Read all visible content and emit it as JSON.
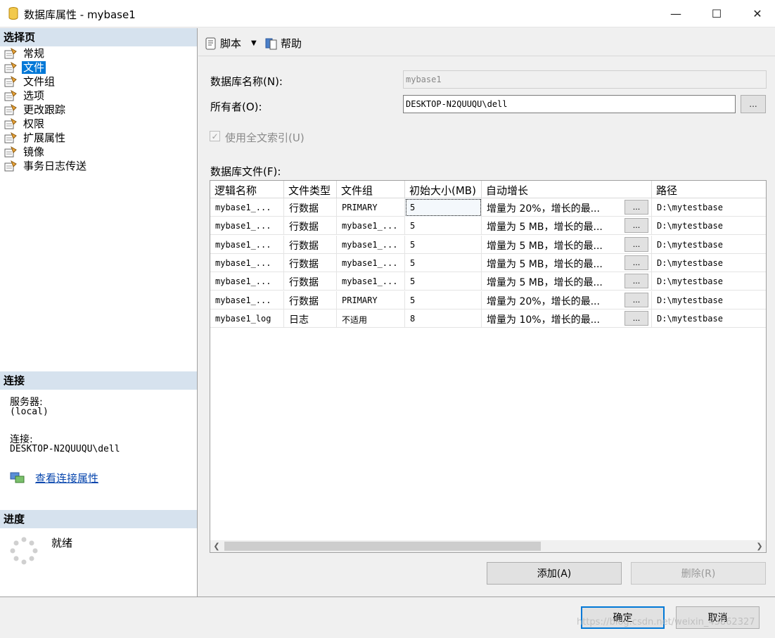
{
  "window": {
    "title": "数据库属性 - mybase1"
  },
  "left": {
    "select_page_header": "选择页",
    "pages": [
      "常规",
      "文件",
      "文件组",
      "选项",
      "更改跟踪",
      "权限",
      "扩展属性",
      "镜像",
      "事务日志传送"
    ],
    "selected_index": 1,
    "connection_header": "连接",
    "server_label": "服务器:",
    "server_value": "(local)",
    "connection_label": "连接:",
    "connection_value": "DESKTOP-N2QUUQU\\dell",
    "view_props_link": "查看连接属性",
    "progress_header": "进度",
    "progress_status": "就绪"
  },
  "toolbar": {
    "script_label": "脚本",
    "help_label": "帮助"
  },
  "form": {
    "db_name_label": "数据库名称(N):",
    "db_name_value": "mybase1",
    "owner_label": "所有者(O):",
    "owner_value": "DESKTOP-N2QUUQU\\dell",
    "ellipsis": "...",
    "fulltext_label": "使用全文索引(U)",
    "files_label": "数据库文件(F):"
  },
  "grid": {
    "columns": [
      "逻辑名称",
      "文件类型",
      "文件组",
      "初始大小(MB)",
      "自动增长",
      "路径"
    ],
    "rows": [
      [
        "mybase1_...",
        "行数据",
        "PRIMARY",
        "5",
        "增量为 20%，增长的最...",
        "D:\\mytestbase"
      ],
      [
        "mybase1_...",
        "行数据",
        "mybase1_...",
        "5",
        "增量为 5 MB，增长的最...",
        "D:\\mytestbase"
      ],
      [
        "mybase1_...",
        "行数据",
        "mybase1_...",
        "5",
        "增量为 5 MB，增长的最...",
        "D:\\mytestbase"
      ],
      [
        "mybase1_...",
        "行数据",
        "mybase1_...",
        "5",
        "增量为 5 MB，增长的最...",
        "D:\\mytestbase"
      ],
      [
        "mybase1_...",
        "行数据",
        "mybase1_...",
        "5",
        "增量为 5 MB，增长的最...",
        "D:\\mytestbase"
      ],
      [
        "mybase1_...",
        "行数据",
        "PRIMARY",
        "5",
        "增量为 20%，增长的最...",
        "D:\\mytestbase"
      ],
      [
        "mybase1_log",
        "日志",
        "不适用",
        "8",
        "增量为 10%，增长的最...",
        "D:\\mytestbase"
      ]
    ]
  },
  "buttons": {
    "add": "添加(A)",
    "remove": "删除(R)",
    "ok": "确定",
    "cancel": "取消"
  },
  "watermark": "https://blog.csdn.net/weixin_43862327"
}
